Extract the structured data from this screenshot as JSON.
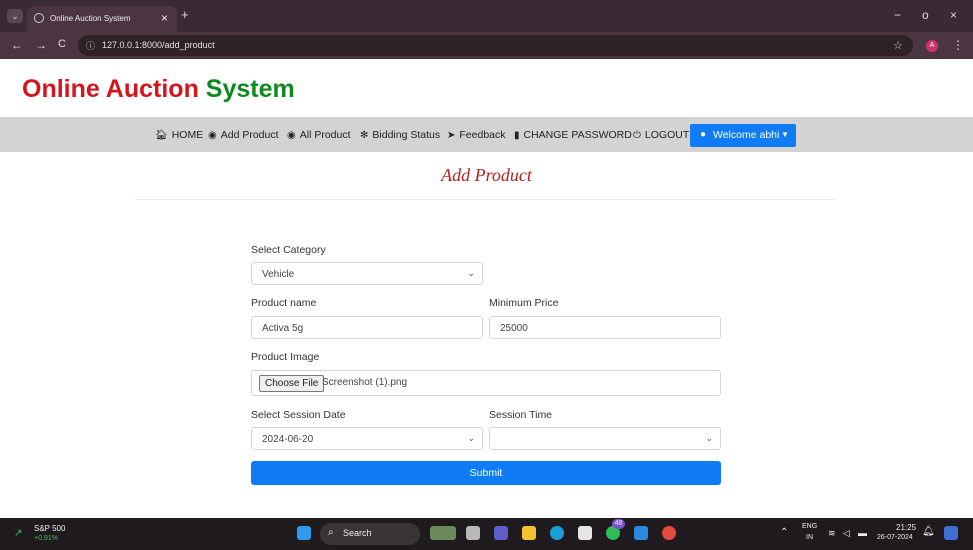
{
  "browser": {
    "tab_title": "Online Auction System",
    "tab_close": "×",
    "new_tab": "+",
    "url": "127.0.0.1:8000/add_product",
    "back": "←",
    "forward": "→",
    "reload": "C",
    "minimize": "−",
    "maximize": "o",
    "close": "×",
    "profile_initial": "A"
  },
  "brand": {
    "word1": "Online Auction",
    "word2": "System",
    "color1": "#d6141d",
    "color2": "#10891e"
  },
  "nav": {
    "items": [
      {
        "icon": "home-icon",
        "label": "HOME"
      },
      {
        "icon": "eye-icon",
        "label": "Add Product"
      },
      {
        "icon": "eye-icon",
        "label": "All Product"
      },
      {
        "icon": "gear-icon",
        "label": "Bidding Status"
      },
      {
        "icon": "send-icon",
        "label": "Feedback"
      },
      {
        "icon": "file-icon",
        "label": "CHANGE PASSWORD"
      },
      {
        "icon": "power-icon",
        "label": "LOGOUT"
      }
    ],
    "welcome": "Welcome abhi",
    "accent": "#0f7bf5"
  },
  "page": {
    "title": "Add Product",
    "title_color": "#b61e20"
  },
  "form": {
    "category": {
      "label": "Select Category",
      "value": "Vehicle"
    },
    "product_name": {
      "label": "Product name",
      "value": "Activa 5g"
    },
    "min_price": {
      "label": "Minimum Price",
      "value": "25000"
    },
    "image": {
      "label": "Product Image",
      "button": "Choose File",
      "file": "Screenshot (1).png"
    },
    "session_date": {
      "label": "Select Session Date",
      "value": "2024-06-20"
    },
    "session_time": {
      "label": "Session Time",
      "value": ""
    },
    "submit": "Submit"
  },
  "taskbar": {
    "stock_name": "S&P 500",
    "stock_change": "+0.91%",
    "search": "Search",
    "lang1": "ENG",
    "lang2": "IN",
    "time": "21:25",
    "date": "26-07-2024",
    "chat_badge": "48"
  }
}
